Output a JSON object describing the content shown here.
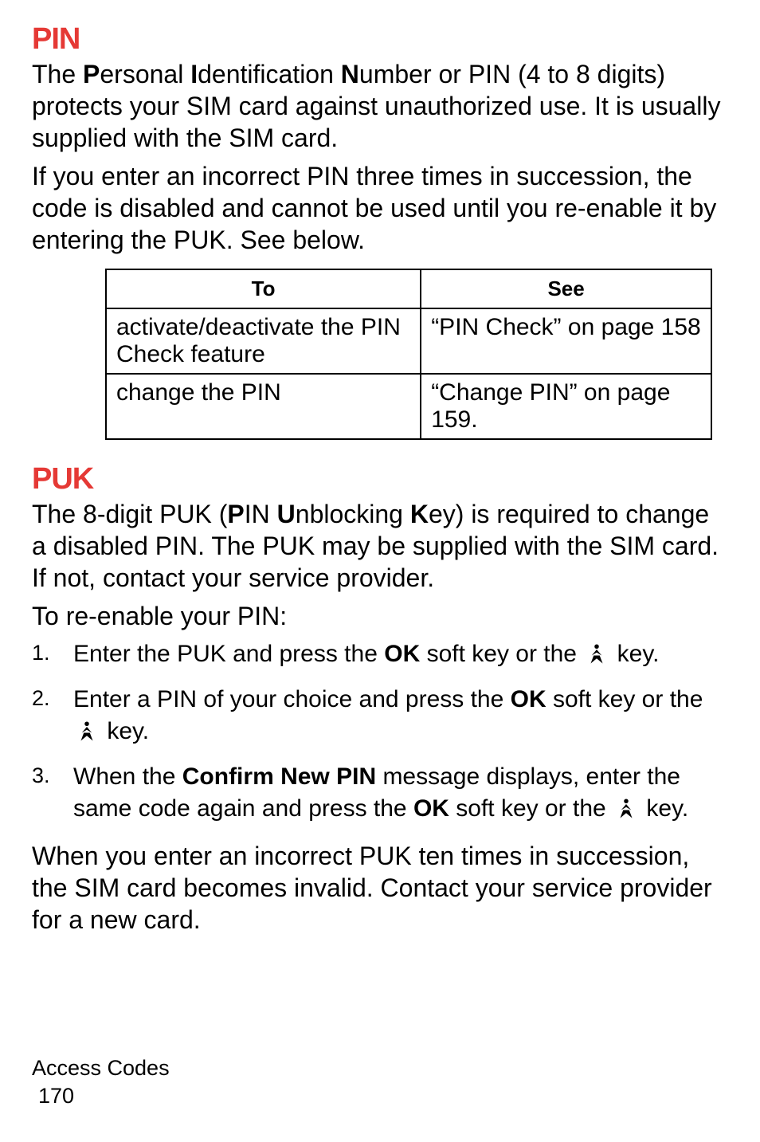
{
  "pin": {
    "heading": "PIN",
    "para1_parts": [
      "The ",
      "P",
      "ersonal ",
      "I",
      "dentification ",
      "N",
      "umber or PIN (4 to 8 digits) protects your SIM card against unauthorized use. It is usually supplied with the SIM card."
    ],
    "para2": "If you enter an incorrect PIN three times in succession, the code is disabled and cannot be used until you re-enable it by entering the PUK. See below."
  },
  "table": {
    "headers": {
      "to": "To",
      "see": "See"
    },
    "rows": [
      {
        "to": "activate/deactivate the PIN Check feature",
        "see": "“PIN Check” on page 158"
      },
      {
        "to": "change the PIN",
        "see": "“Change PIN” on page 159."
      }
    ]
  },
  "puk": {
    "heading": "PUK",
    "para1_parts": [
      "The 8-digit PUK (",
      "P",
      "IN ",
      "U",
      "nblocking ",
      "K",
      "ey) is required to change a disabled PIN. The PUK may be supplied with the SIM card. If not, contact your service provider."
    ],
    "para2": "To re-enable your PIN:",
    "steps": [
      {
        "num": "1.",
        "pre": "Enter the PUK and press the ",
        "bold1": "OK",
        "mid": " soft key or the  ",
        "post": "  key."
      },
      {
        "num": "2.",
        "pre": "Enter a PIN of your choice and press the ",
        "bold1": "OK",
        "mid": " soft key or the ",
        "post": " key."
      },
      {
        "num": "3.",
        "pre": "When the ",
        "bold1": "Confirm New PIN",
        "mid": " message displays, enter the same code again and press the ",
        "bold2": "OK",
        "mid2": " soft key or the  ",
        "post": "  key."
      }
    ],
    "para3": "When you enter an incorrect PUK ten times in succession, the SIM card becomes invalid. Contact your service provider for a new card."
  },
  "footer": {
    "section": "Access Codes",
    "page": "170"
  }
}
